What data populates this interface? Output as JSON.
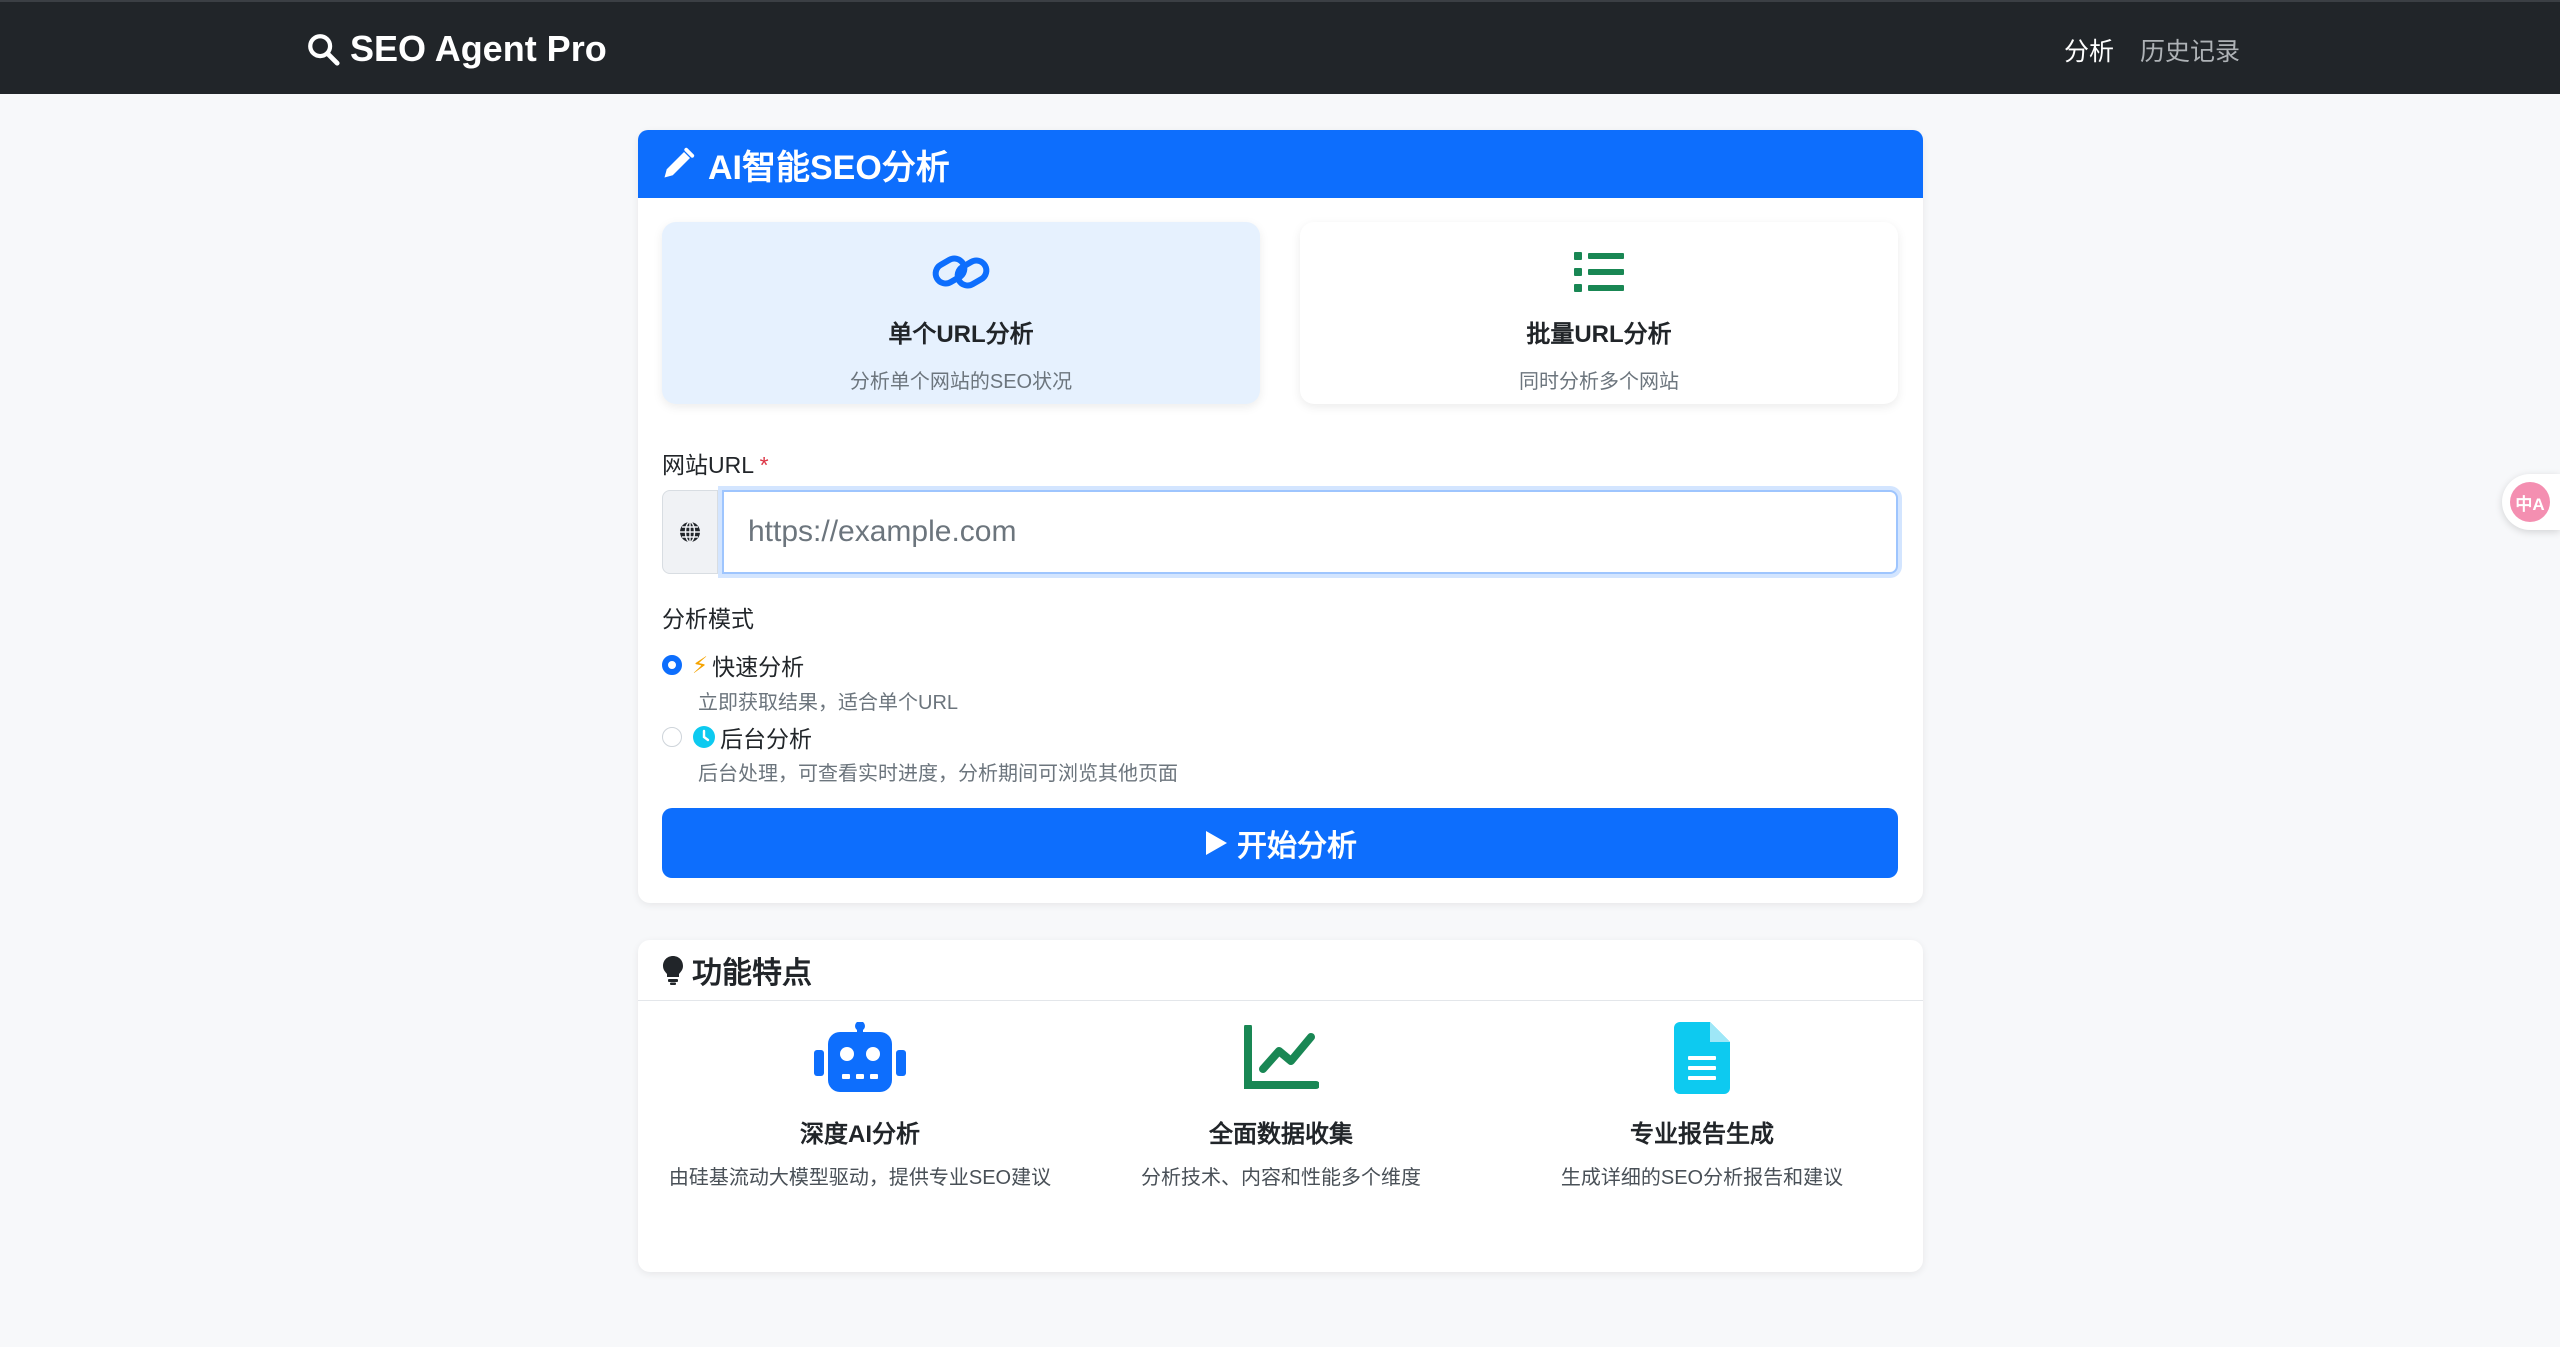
{
  "navbar": {
    "brand": "SEO Agent Pro",
    "links": [
      "分析",
      "历史记录"
    ]
  },
  "analysis_card": {
    "title": "AI智能SEO分析",
    "modes": [
      {
        "title": "单个URL分析",
        "desc": "分析单个网站的SEO状况",
        "icon": "link-icon",
        "selected": true
      },
      {
        "title": "批量URL分析",
        "desc": "同时分析多个网站",
        "icon": "list-icon",
        "selected": false
      }
    ],
    "url_label": "网站URL",
    "required_mark": "*",
    "url_placeholder": "https://example.com",
    "url_value": "",
    "analysis_mode_label": "分析模式",
    "options": [
      {
        "icon": "⚡",
        "label": "快速分析",
        "help": "立即获取结果，适合单个URL",
        "checked": true
      },
      {
        "icon": "clock-icon",
        "label": "后台分析",
        "help": "后台处理，可查看实时进度，分析期间可浏览其他页面",
        "checked": false
      }
    ],
    "start_button": "开始分析"
  },
  "features_card": {
    "title": "功能特点",
    "features": [
      {
        "title": "深度AI分析",
        "desc": "由硅基流动大模型驱动，提供专业SEO建议",
        "icon": "robot-icon"
      },
      {
        "title": "全面数据收集",
        "desc": "分析技术、内容和性能多个维度",
        "icon": "chart-line-icon"
      },
      {
        "title": "专业报告生成",
        "desc": "生成详细的SEO分析报告和建议",
        "icon": "document-icon"
      }
    ]
  },
  "floating_translate": "中A",
  "colors": {
    "primary": "#0d6efd",
    "success": "#198754",
    "info": "#0dcaf0",
    "navbar": "#212529"
  }
}
